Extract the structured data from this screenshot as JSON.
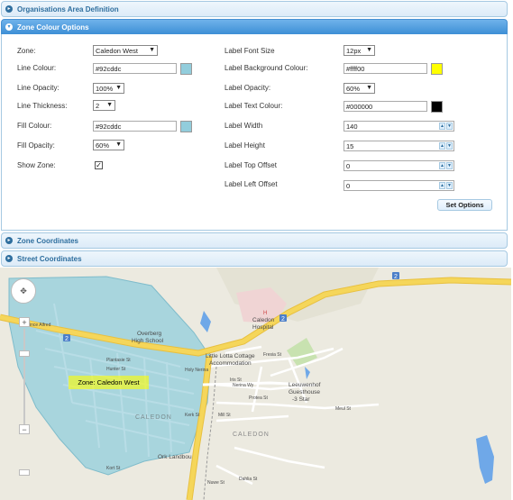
{
  "accordion": {
    "org_area": "Organisations Area Definition",
    "zone_colour": "Zone Colour Options",
    "zone_coords": "Zone Coordinates",
    "street_coords": "Street Coordinates"
  },
  "form": {
    "zone": {
      "label": "Zone:",
      "value": "Caledon West"
    },
    "line_colour": {
      "label": "Line Colour:",
      "value": "#92cddc",
      "swatch": "#92cddc"
    },
    "line_opacity": {
      "label": "Line Opacity:",
      "value": "100%"
    },
    "line_thickness": {
      "label": "Line Thickness:",
      "value": "2"
    },
    "fill_colour": {
      "label": "Fill Colour:",
      "value": "#92cddc",
      "swatch": "#92cddc"
    },
    "fill_opacity": {
      "label": "Fill Opacity:",
      "value": "60%"
    },
    "show_zone": {
      "label": "Show Zone:",
      "checked": true
    },
    "label_font_size": {
      "label": "Label Font Size",
      "value": "12px"
    },
    "label_bg_colour": {
      "label": "Label Background Colour:",
      "value": "#ffff00",
      "swatch": "#ffff00"
    },
    "label_opacity": {
      "label": "Label Opacity:",
      "value": "60%"
    },
    "label_text_colour": {
      "label": "Label Text Colour:",
      "value": "#000000",
      "swatch": "#000000"
    },
    "label_width": {
      "label": "Label Width",
      "value": "140"
    },
    "label_height": {
      "label": "Label Height",
      "value": "15"
    },
    "label_top_offset": {
      "label": "Label Top Offset",
      "value": "0"
    },
    "label_left_offset": {
      "label": "Label Left Offset",
      "value": "0"
    },
    "set_options": "Set Options"
  },
  "map": {
    "zone_label": "Zone: Caledon West",
    "zoom_in": "+",
    "zoom_out": "−",
    "places": {
      "overberg": "Overberg",
      "high_school": "High School",
      "caledon_hospital_1": "Caledon",
      "caledon_hospital_2": "Hospital",
      "little_lotta_1": "Little Lotta Cottage",
      "little_lotta_2": "Accommodation",
      "leeuwenhof_1": "Leeuwenhof",
      "leeuwenhof_2": "Guesthouse",
      "leeuwenhof_3": "-3 Star",
      "caledon_town": "CALEDON",
      "caledon_zone": "CALEDON",
      "ork_landbou": "Ork Landbou",
      "hospital_h": "H"
    },
    "streets": {
      "plantasie": "Plantasie St",
      "hunter": "Hunter St",
      "nerina": "Nerina Wy",
      "protea": "Protea St",
      "meul": "Meul St",
      "mill": "Mill St",
      "kerk": "Kerk St",
      "nuwe": "Nuwe St",
      "dahlia": "Dahlia St",
      "fresia": "Fresia St",
      "iris": "Iris St",
      "prince": "Prince Alfred",
      "kort": "Kort St",
      "holy": "Holy Nerina"
    },
    "route_badges": [
      "2",
      "2",
      "2"
    ],
    "colors": {
      "zone_fill": "#92cddc",
      "road": "#f5d65a",
      "water": "#6fa8e8",
      "hospital": "#f0d4d4",
      "park": "#c8e2b0"
    }
  }
}
